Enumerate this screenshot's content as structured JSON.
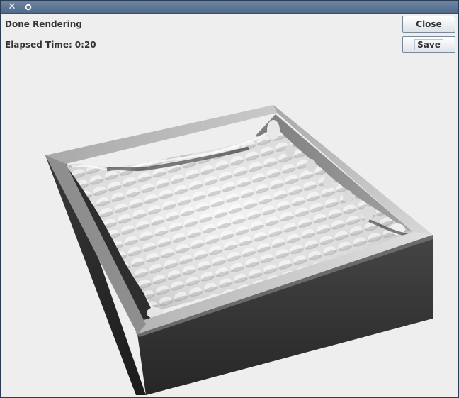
{
  "window": {
    "close_icon": "close-icon",
    "restore_icon": "restore-icon"
  },
  "status": {
    "rendering": "Done Rendering",
    "elapsed_label": "Elapsed Time:",
    "elapsed_value": "0:20"
  },
  "buttons": {
    "close_label": "Close",
    "save_label": "Save"
  },
  "colors": {
    "titlebar": "#5a7293",
    "background": "#eeeeee"
  }
}
